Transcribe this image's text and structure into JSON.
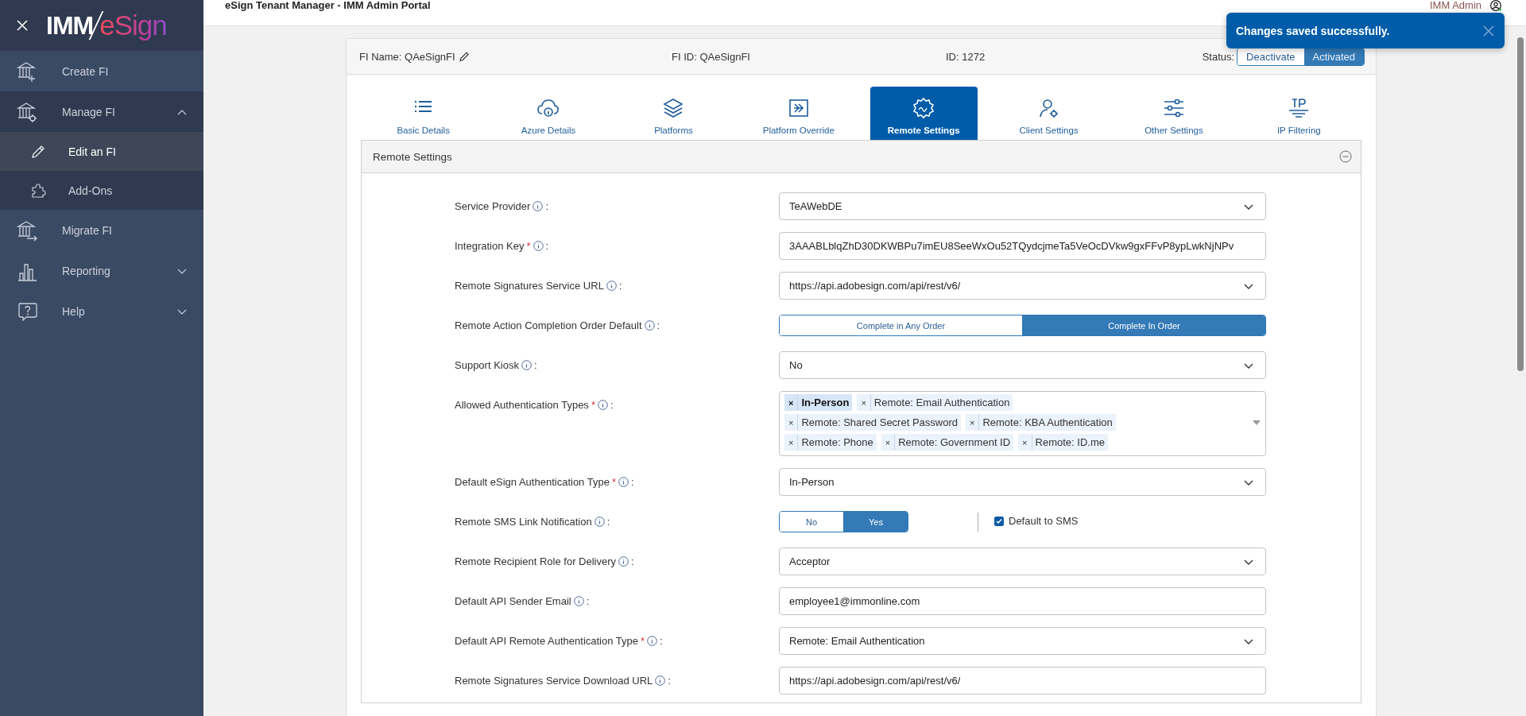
{
  "header": {
    "title": "eSign Tenant Manager - IMM Admin Portal",
    "user": "IMM Admin"
  },
  "sidebar": {
    "logo": {
      "left": "IMM",
      "right": "eSign"
    },
    "items": [
      {
        "label": "Create FI",
        "kind": "link"
      },
      {
        "label": "Manage FI",
        "kind": "group",
        "expanded": true,
        "children": [
          {
            "label": "Edit an FI",
            "selected": true
          },
          {
            "label": "Add-Ons",
            "selected": false
          }
        ]
      },
      {
        "label": "Migrate FI",
        "kind": "link"
      },
      {
        "label": "Reporting",
        "kind": "group",
        "expanded": false
      },
      {
        "label": "Help",
        "kind": "group",
        "expanded": false
      }
    ]
  },
  "card": {
    "fi_name": "FI Name: QAeSignFI",
    "fi_id": "FI ID: QAeSignFI",
    "id": "ID: 1272",
    "status_label": "Status:",
    "status_options": [
      {
        "label": "Deactivate",
        "selected": false
      },
      {
        "label": "Activated",
        "selected": true
      }
    ],
    "tabs": [
      {
        "label": "Basic Details",
        "selected": false
      },
      {
        "label": "Azure Details",
        "selected": false
      },
      {
        "label": "Platforms",
        "selected": false
      },
      {
        "label": "Platform Override",
        "selected": false
      },
      {
        "label": "Remote Settings",
        "selected": true
      },
      {
        "label": "Client Settings",
        "selected": false
      },
      {
        "label": "Other Settings",
        "selected": false
      },
      {
        "label": "IP Filtering",
        "selected": false
      }
    ],
    "section": {
      "title": "Remote Settings",
      "expanded": true,
      "fields": [
        {
          "kind": "select",
          "label": "Service Provider",
          "suffix": ":",
          "value": "TeAWebDE"
        },
        {
          "kind": "input",
          "label": "Integration Key",
          "required_mark": "*",
          "suffix": ":",
          "value": "3AAABLblqZhD30DKWBPu7imEU8SeeWxOu52TQydcjmeTa5VeOcDVkw9gxFFvP8ypLwkNjNPv"
        },
        {
          "kind": "select",
          "label": "Remote Signatures Service URL",
          "suffix": ":",
          "value": "https://api.adobesign.com/api/rest/v6/"
        },
        {
          "kind": "toggle",
          "label": "Remote Action Completion Order Default",
          "suffix": ":",
          "options": [
            {
              "label": "Complete in Any Order",
              "selected": false
            },
            {
              "label": "Complete In Order",
              "selected": true
            }
          ]
        },
        {
          "kind": "select",
          "label": "Support Kiosk",
          "suffix": ":",
          "value": "No"
        },
        {
          "kind": "tags",
          "label": "Allowed Authentication Types",
          "required_mark": "*",
          "suffix": ":",
          "tags": [
            {
              "remove": "×",
              "label": "In-Person",
              "selected": true
            },
            {
              "remove": "×",
              "label": "Remote: Email Authentication",
              "selected": false
            },
            {
              "remove": "×",
              "label": "Remote: Shared Secret Password",
              "selected": false
            },
            {
              "remove": "×",
              "label": "Remote: KBA Authentication",
              "selected": false
            },
            {
              "remove": "×",
              "label": "Remote: Phone",
              "selected": false
            },
            {
              "remove": "×",
              "label": "Remote: Government ID",
              "selected": false
            },
            {
              "remove": "×",
              "label": "Remote: ID.me",
              "selected": false
            }
          ]
        },
        {
          "kind": "select",
          "label": "Default eSign Authentication Type",
          "required_mark": "*",
          "suffix": ":",
          "value": "In-Person"
        },
        {
          "kind": "toggle",
          "label": "Remote SMS Link Notification",
          "suffix": ":",
          "options": [
            {
              "label": "No",
              "selected": false
            },
            {
              "label": "Yes",
              "selected": true
            }
          ],
          "checkbox": {
            "label": "Default to SMS",
            "checked": true
          }
        },
        {
          "kind": "select",
          "label": "Remote Recipient Role for Delivery",
          "suffix": ":",
          "value": "Acceptor"
        },
        {
          "kind": "input",
          "label": "Default API Sender Email",
          "suffix": ":",
          "value": "employee1@immonline.com"
        },
        {
          "kind": "select",
          "label": "Default API Remote Authentication Type",
          "required_mark": "*",
          "suffix": ":",
          "value": "Remote: Email Authentication"
        },
        {
          "kind": "input",
          "label": "Remote Signatures Service Download URL",
          "suffix": ":",
          "value": "https://api.adobesign.com/api/rest/v6/"
        }
      ]
    }
  },
  "toast": {
    "message": "Changes saved successfully."
  }
}
